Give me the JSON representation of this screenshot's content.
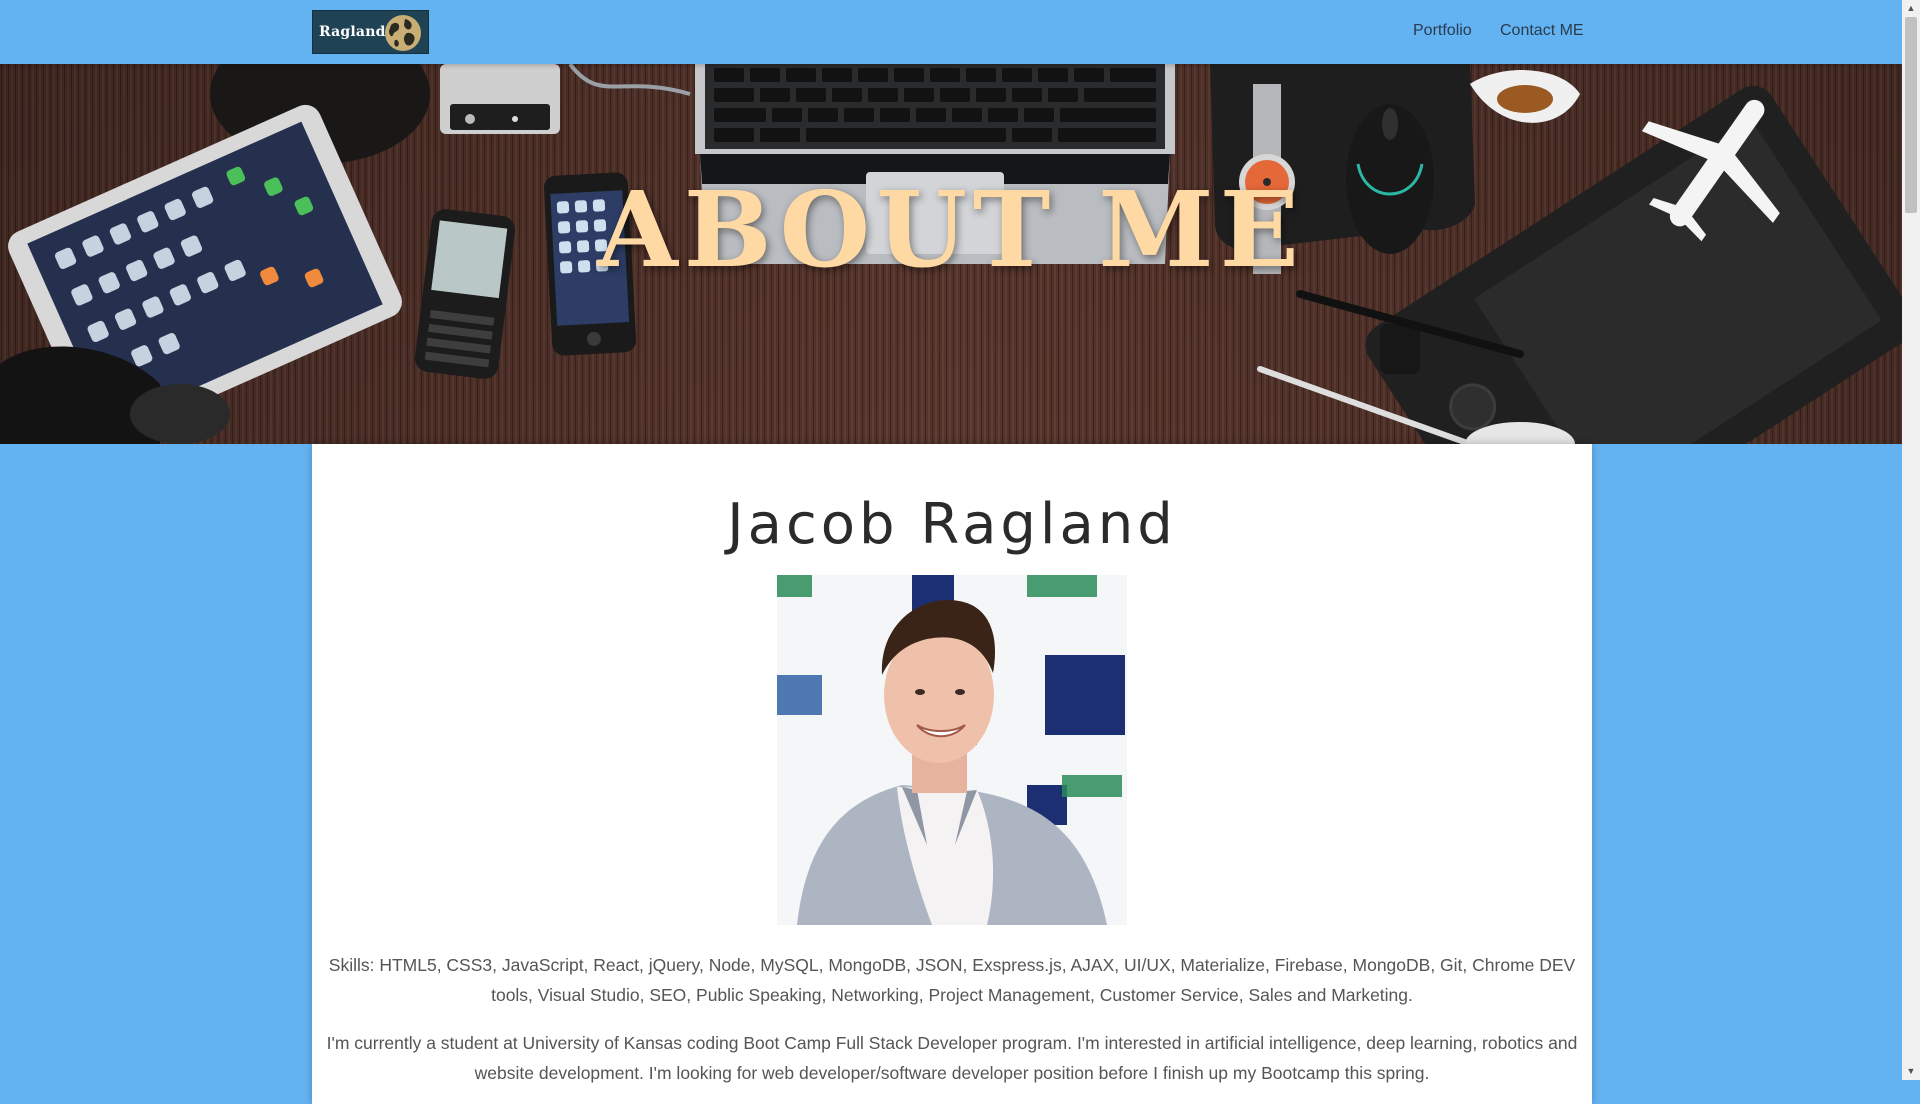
{
  "navbar": {
    "logo_text": "Ragland",
    "links": [
      {
        "label": "Portfolio"
      },
      {
        "label": "Contact ME"
      }
    ]
  },
  "hero": {
    "title": "ABOUT ME"
  },
  "profile": {
    "name": "Jacob Ragland",
    "skills": "Skills: HTML5, CSS3, JavaScript, React, jQuery, Node, MySQL, MongoDB, JSON, Exspress.js, AJAX, UI/UX, Materialize, Firebase, MongoDB, Git, Chrome DEV tools, Visual Studio, SEO, Public Speaking, Networking, Project Management, Customer Service, Sales and Marketing.",
    "bio": "I'm currently a student at University of Kansas coding Boot Camp Full Stack Developer program. I'm interested in artificial intelligence, deep learning, robotics and website development. I'm looking for web developer/software developer position before I finish up my Bootcamp this spring."
  },
  "colors": {
    "page_background": "#63b3f3",
    "navbar_background": "#63b3f3",
    "hero_title": "#ffd9a3",
    "card_background": "#ffffff",
    "body_text": "#555555"
  },
  "icons": {
    "logo_globe": "globe-icon",
    "scroll_up": "chevron-up-icon",
    "scroll_down": "chevron-down-icon"
  }
}
